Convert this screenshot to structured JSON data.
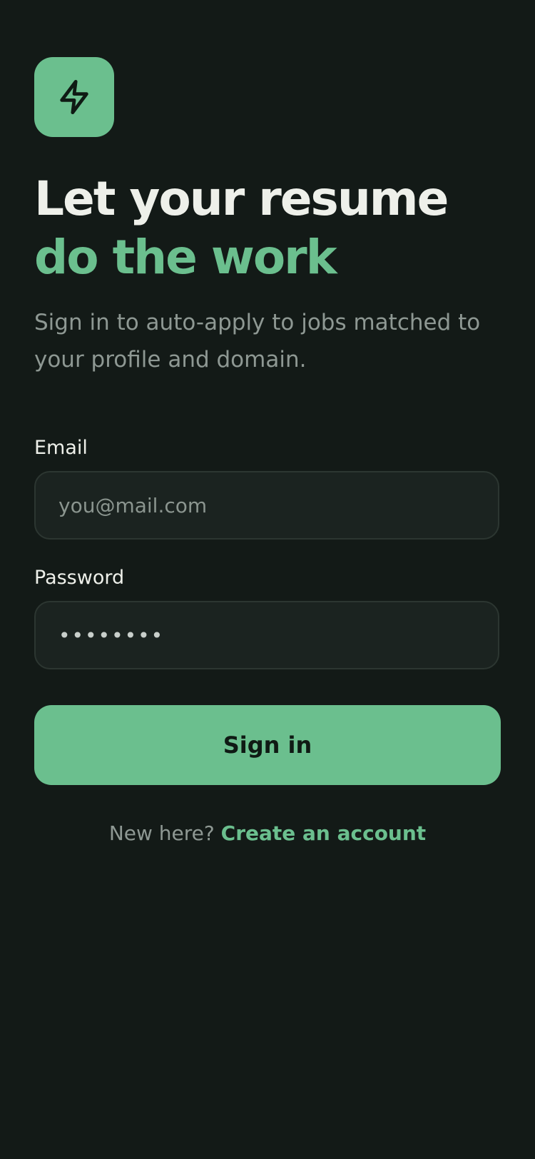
{
  "app": {
    "logo_icon": "lightning-bolt-icon",
    "accent_color": "#6bbf8e",
    "background_color": "#131a17"
  },
  "hero": {
    "title_line1": "Let your resume",
    "title_line2": "do the work",
    "subtitle": "Sign in to auto-apply to jobs matched to your profile and domain."
  },
  "form": {
    "email_label": "Email",
    "email_placeholder": "you@mail.com",
    "email_value": "",
    "password_label": "Password",
    "password_value": "••••••••",
    "submit_label": "Sign in"
  },
  "footer": {
    "prompt": "New here?",
    "link_label": "Create an account"
  }
}
